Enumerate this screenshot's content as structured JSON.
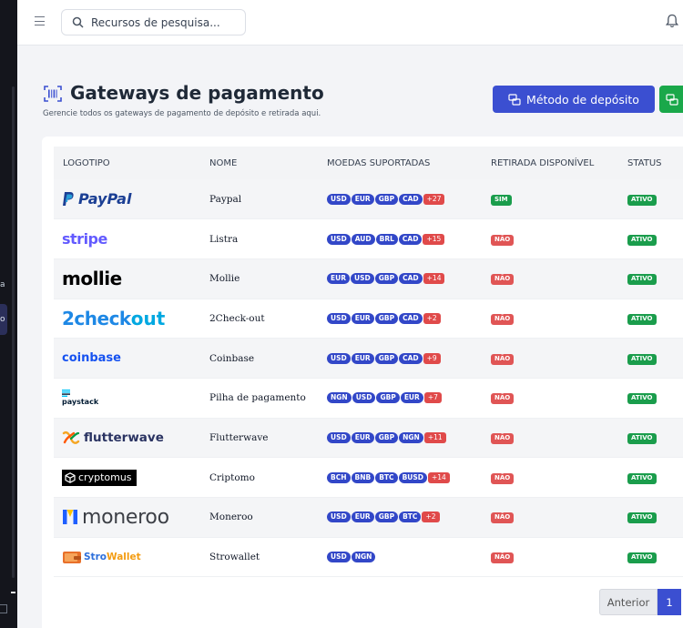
{
  "sidebar": {
    "fragment_1": "a",
    "fragment_2": "o"
  },
  "topbar": {
    "search_placeholder": "Recursos de pesquisa..."
  },
  "page": {
    "title": "Gateways de pagamento",
    "subtitle": "Gerencie todos os gateways de pagamento de depósito e retirada aqui.",
    "deposit_button": "Método de depósito"
  },
  "table": {
    "columns": [
      "LOGOTIPO",
      "NOME",
      "MOEDAS SUPORTADAS",
      "RETIRADA DISPONÍVEL",
      "STATUS"
    ],
    "rows": [
      {
        "logo": "PayPal",
        "name": "Paypal",
        "currencies": [
          "USD",
          "EUR",
          "GBP",
          "CAD"
        ],
        "more": "+27",
        "withdraw": "SIM",
        "status": "ATIVO"
      },
      {
        "logo": "stripe",
        "name": "Listra",
        "currencies": [
          "USD",
          "AUD",
          "BRL",
          "CAD"
        ],
        "more": "+15",
        "withdraw": "NÃO",
        "status": "ATIVO"
      },
      {
        "logo": "mollie",
        "name": "Mollie",
        "currencies": [
          "EUR",
          "USD",
          "GBP",
          "CAD"
        ],
        "more": "+14",
        "withdraw": "NÃO",
        "status": "ATIVO"
      },
      {
        "logo_a": "2check",
        "logo_b": "out",
        "name": "2Check-out",
        "currencies": [
          "USD",
          "EUR",
          "GBP",
          "CAD"
        ],
        "more": "+2",
        "withdraw": "NÃO",
        "status": "ATIVO"
      },
      {
        "logo": "coinbase",
        "name": "Coinbase",
        "currencies": [
          "USD",
          "EUR",
          "GBP",
          "CAD"
        ],
        "more": "+9",
        "withdraw": "NÃO",
        "status": "ATIVO"
      },
      {
        "logo": "paystack",
        "name": "Pilha de pagamento",
        "currencies": [
          "NGN",
          "USD",
          "GBP",
          "EUR"
        ],
        "more": "+7",
        "withdraw": "NÃO",
        "status": "ATIVO"
      },
      {
        "logo": "flutterwave",
        "name": "Flutterwave",
        "currencies": [
          "USD",
          "EUR",
          "GBP",
          "NGN"
        ],
        "more": "+11",
        "withdraw": "NÃO",
        "status": "ATIVO"
      },
      {
        "logo": "cryptomus",
        "name": "Criptomo",
        "currencies": [
          "BCH",
          "BNB",
          "BTC",
          "BUSD"
        ],
        "more": "+14",
        "withdraw": "NÃO",
        "status": "ATIVO"
      },
      {
        "logo": "moneroo",
        "name": "Moneroo",
        "currencies": [
          "USD",
          "EUR",
          "GBP",
          "BTC"
        ],
        "more": "+2",
        "withdraw": "NÃO",
        "status": "ATIVO"
      },
      {
        "logo_a": "Stro",
        "logo_b": "Wallet",
        "name": "Strowallet",
        "currencies": [
          "USD",
          "NGN"
        ],
        "more": "",
        "withdraw": "NÃO",
        "status": "ATIVO"
      }
    ]
  },
  "pagination": {
    "prev": "Anterior",
    "current": "1"
  },
  "colors": {
    "primary": "#3b4fd1",
    "success": "#1a9d4c",
    "danger": "#e05555",
    "sidebar": "#14151c"
  }
}
